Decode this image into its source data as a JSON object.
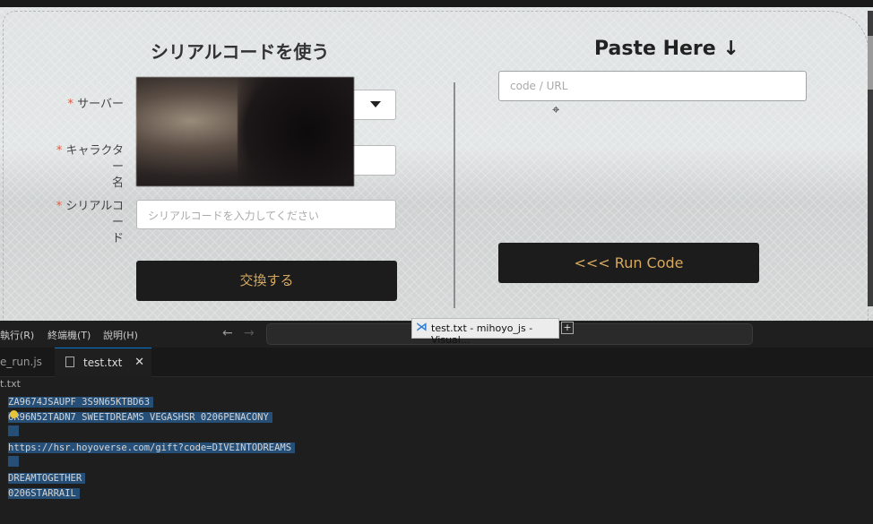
{
  "web": {
    "left_title": "シリアルコードを使う",
    "right_title": "Paste Here ↓",
    "required_mark": "*",
    "server_label": "サーバー",
    "character_label_1": "キャラクター",
    "character_label_2": "名",
    "serial_label_1": "シリアルコー",
    "serial_label_2": "ド",
    "serial_placeholder": "シリアルコードを入力してください",
    "redeem_button": "交換する",
    "paste_placeholder": "code / URL",
    "run_button": "<<< Run Code"
  },
  "vscode": {
    "menu": [
      "執行(R)",
      "終端機(T)",
      "說明(H)"
    ],
    "taskbar_popup_title": "test.txt - mihoyo_js - Visual...",
    "tabs": [
      {
        "label": "e_run.js",
        "active": false
      },
      {
        "label": "test.txt",
        "active": true
      }
    ],
    "breadcrumb": "t.txt",
    "lines": [
      "ZA9674JSAUPF 3S9N65KTBD63",
      "6R96N52TADN7 SWEETDREAMS VEGASHSR 0206PENACONY",
      "",
      "https://hsr.hoyoverse.com/gift?code=DIVEINTODREAMS",
      "",
      "DREAMTOGETHER",
      "0206STARRAIL"
    ]
  },
  "colors": {
    "accent_gold": "#d6a960",
    "selection": "#264f78",
    "required_red": "#e05a3a"
  }
}
